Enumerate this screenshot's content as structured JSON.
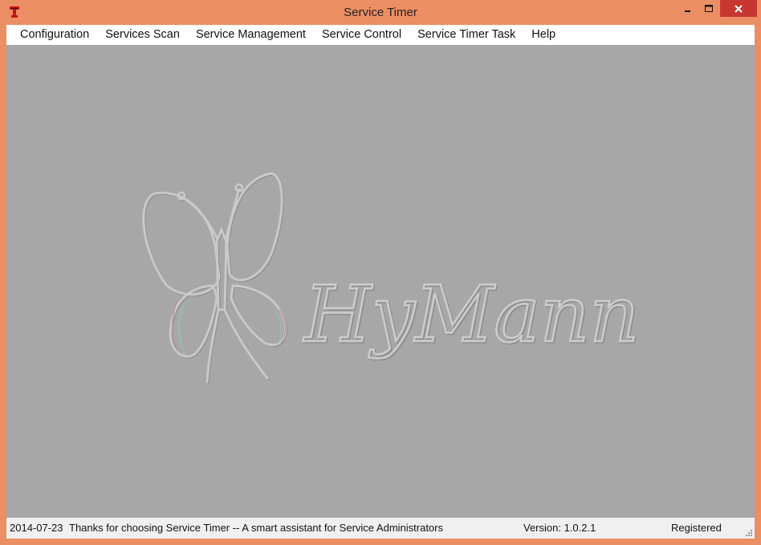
{
  "window": {
    "title": "Service Timer",
    "icon": "t-logo-icon"
  },
  "controls": {
    "minimize_icon": "minimize-icon",
    "maximize_icon": "maximize-icon",
    "close_icon": "close-icon"
  },
  "menu": {
    "items": [
      {
        "label": "Configuration"
      },
      {
        "label": "Services Scan"
      },
      {
        "label": "Service Management"
      },
      {
        "label": "Service Control"
      },
      {
        "label": "Service Timer Task"
      },
      {
        "label": "Help"
      }
    ]
  },
  "watermark": {
    "text": "HyMann",
    "emblem": "butterfly-logo"
  },
  "status": {
    "date": "2014-07-23",
    "message": "Thanks for choosing Service Timer -- A smart assistant for Service Administrators",
    "version": "Version: 1.0.2.1",
    "registration": "Registered"
  },
  "colors": {
    "frame": "#ec8e63",
    "close_button": "#c7372f",
    "client_background": "#a7a7a7"
  }
}
